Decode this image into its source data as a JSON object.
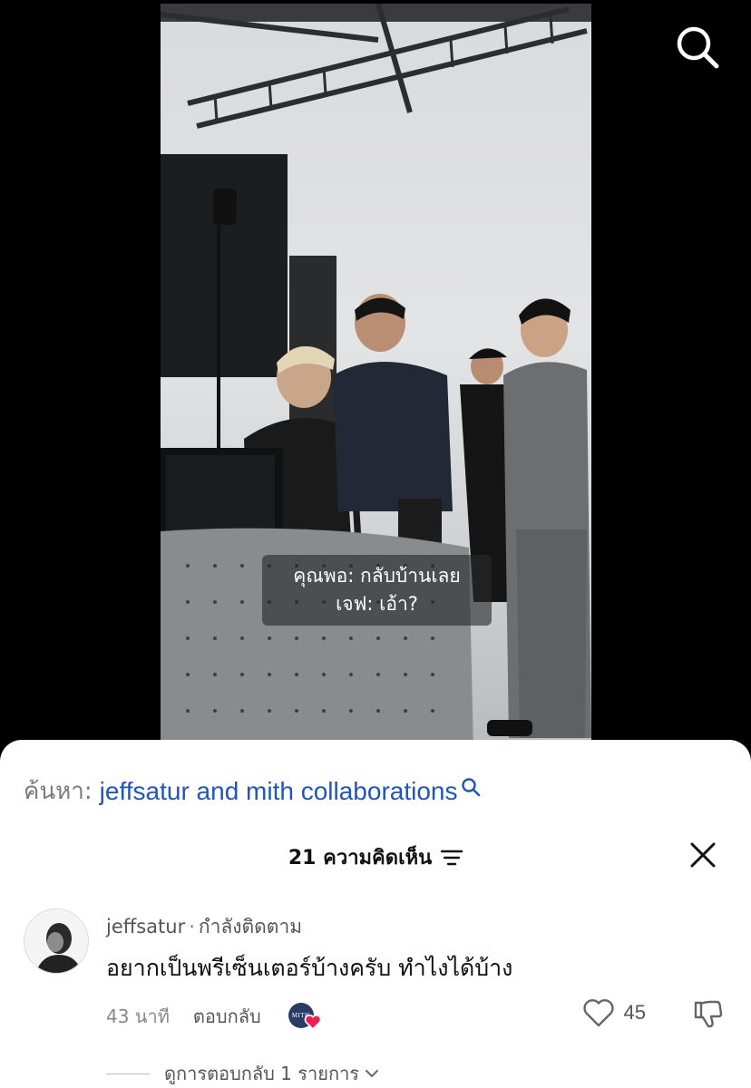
{
  "video": {
    "subtitle_line1": "คุณพอ: กลับบ้านเลย",
    "subtitle_line2": "เจฟ: เอ้า?"
  },
  "search_suggestion": {
    "prefix": "ค้นหา:",
    "query": "jeffsatur and mith collaborations"
  },
  "comments": {
    "title": "21 ความคิดเห็น",
    "items": [
      {
        "username": "jeffsatur",
        "separator": "·",
        "follow_status": "กำลังติดตาม",
        "text": "อยากเป็นพรีเซ็นเตอร์บ้างครับ ทำไงได้บ้าง",
        "time": "43 นาที",
        "reply_label": "ตอบกลับ",
        "creator_avatar_text": "MITH",
        "like_count": "45",
        "view_replies_label": "ดูการตอบกลับ 1 รายการ"
      }
    ]
  },
  "colors": {
    "accent_link": "#1f56b7",
    "creator_heart": "#ee1d52",
    "sheet_background": "#ffffff"
  },
  "icons": [
    "search-icon",
    "sort-icon",
    "close-icon",
    "heart-icon",
    "dislike-icon",
    "chevron-down-icon"
  ]
}
